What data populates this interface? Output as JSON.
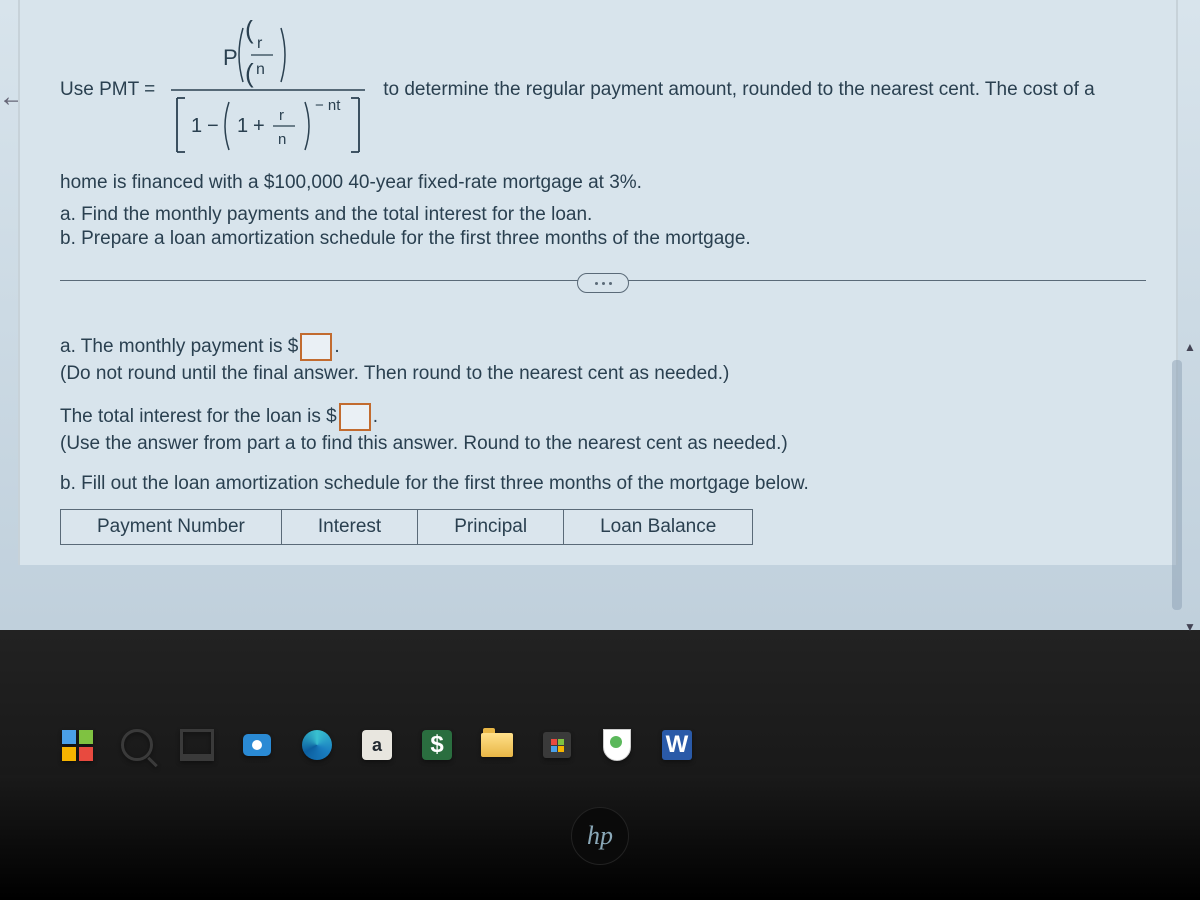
{
  "problem": {
    "lead_in": "Use PMT =",
    "after_formula": "to determine the regular payment amount, rounded to the nearest cent. The cost of a",
    "line2": "home is financed with a $100,000 40-year fixed-rate mortgage at 3%.",
    "part_a": "a. Find the monthly payments and the total interest for the loan.",
    "part_b": "b. Prepare a loan amortization schedule for the first three months of the mortgage.",
    "formula": {
      "P": "P",
      "r": "r",
      "n": "n",
      "one": "1",
      "minus": "−",
      "plus": "+",
      "exp": "− nt"
    }
  },
  "answers": {
    "a_monthly_pre": "a. The monthly payment is $",
    "a_monthly_post": ".",
    "a_monthly_hint": "(Do not round until the final answer. Then round to the nearest cent as needed.)",
    "a_interest_pre": "The total interest for the loan is $",
    "a_interest_post": ".",
    "a_interest_hint": "(Use the answer from part a to find this answer. Round to the nearest cent as needed.)",
    "b_intro": "b. Fill out the loan amortization schedule for the first three months of the mortgage below."
  },
  "table_headers": {
    "c1": "Payment Number",
    "c2": "Interest",
    "c3": "Principal",
    "c4": "Loan Balance"
  },
  "taskbar": {
    "amazon_letter": "a",
    "dollar": "$",
    "word_letter": "W"
  },
  "bezel": {
    "logo": "hp"
  }
}
